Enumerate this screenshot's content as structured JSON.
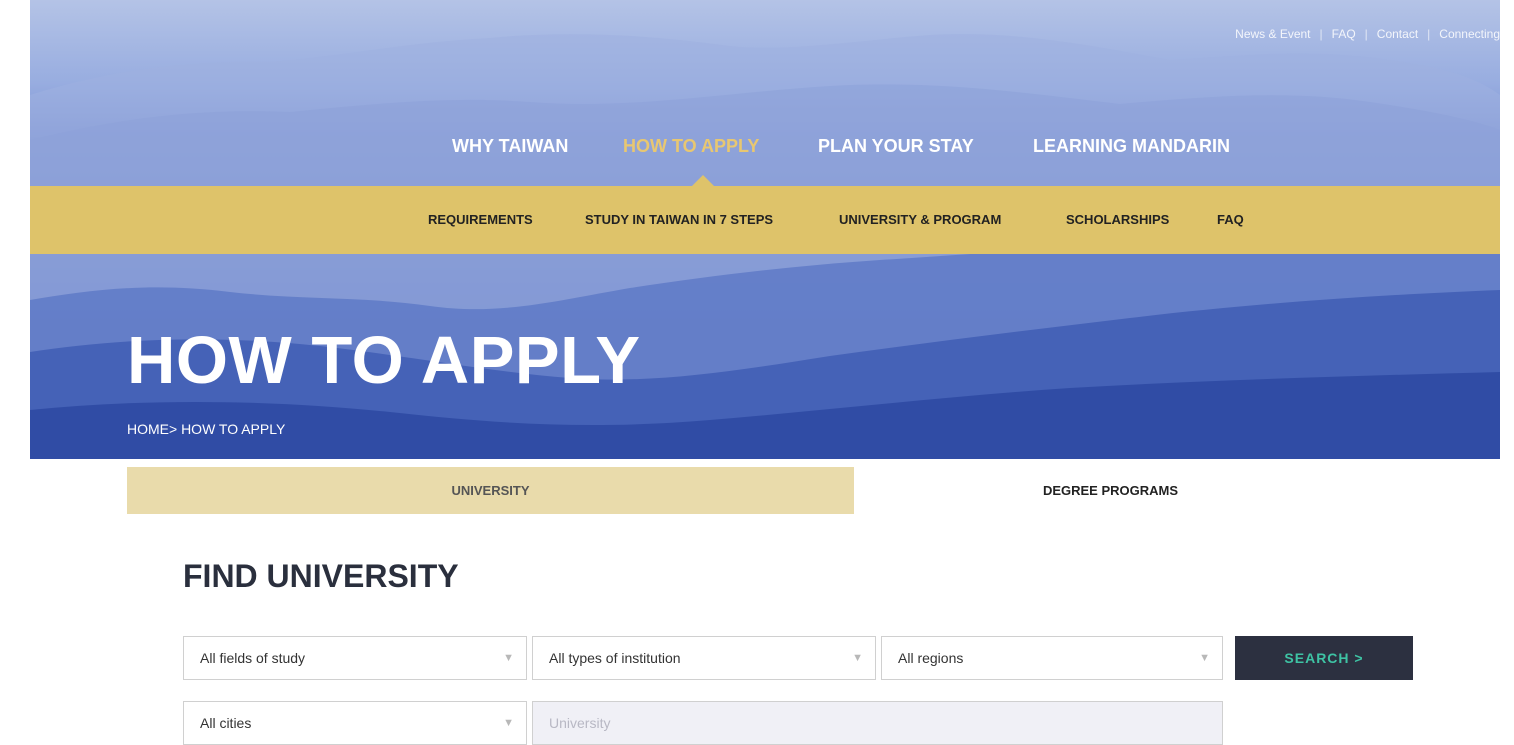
{
  "top_links": [
    "News & Event",
    "FAQ",
    "Contact",
    "Connecting"
  ],
  "main_nav": [
    {
      "label": "WHY TAIWAN",
      "active": false
    },
    {
      "label": "HOW TO APPLY",
      "active": true
    },
    {
      "label": "PLAN YOUR STAY",
      "active": false
    },
    {
      "label": "LEARNING MANDARIN",
      "active": false
    }
  ],
  "sub_nav": [
    "REQUIREMENTS",
    "STUDY IN TAIWAN IN 7 STEPS",
    "UNIVERSITY & PROGRAM",
    "SCHOLARSHIPS",
    "FAQ"
  ],
  "hero": {
    "title": "HOW TO APPLY",
    "breadcrumb": "HOME> HOW TO APPLY"
  },
  "tabs": {
    "university": "UNIVERSITY",
    "degree_programs": "DEGREE PROGRAMS"
  },
  "find": {
    "title": "FIND UNIVERSITY",
    "field_of_study": "All fields of study",
    "institution_type": "All types of institution",
    "region": "All regions",
    "city": "All cities",
    "university_placeholder": "University",
    "search_label": "SEARCH  >"
  },
  "colors": {
    "accent_gold": "#dec36a",
    "active_nav": "#e8c771",
    "search_button": "#2c3040",
    "search_text": "#3ec3a4"
  }
}
